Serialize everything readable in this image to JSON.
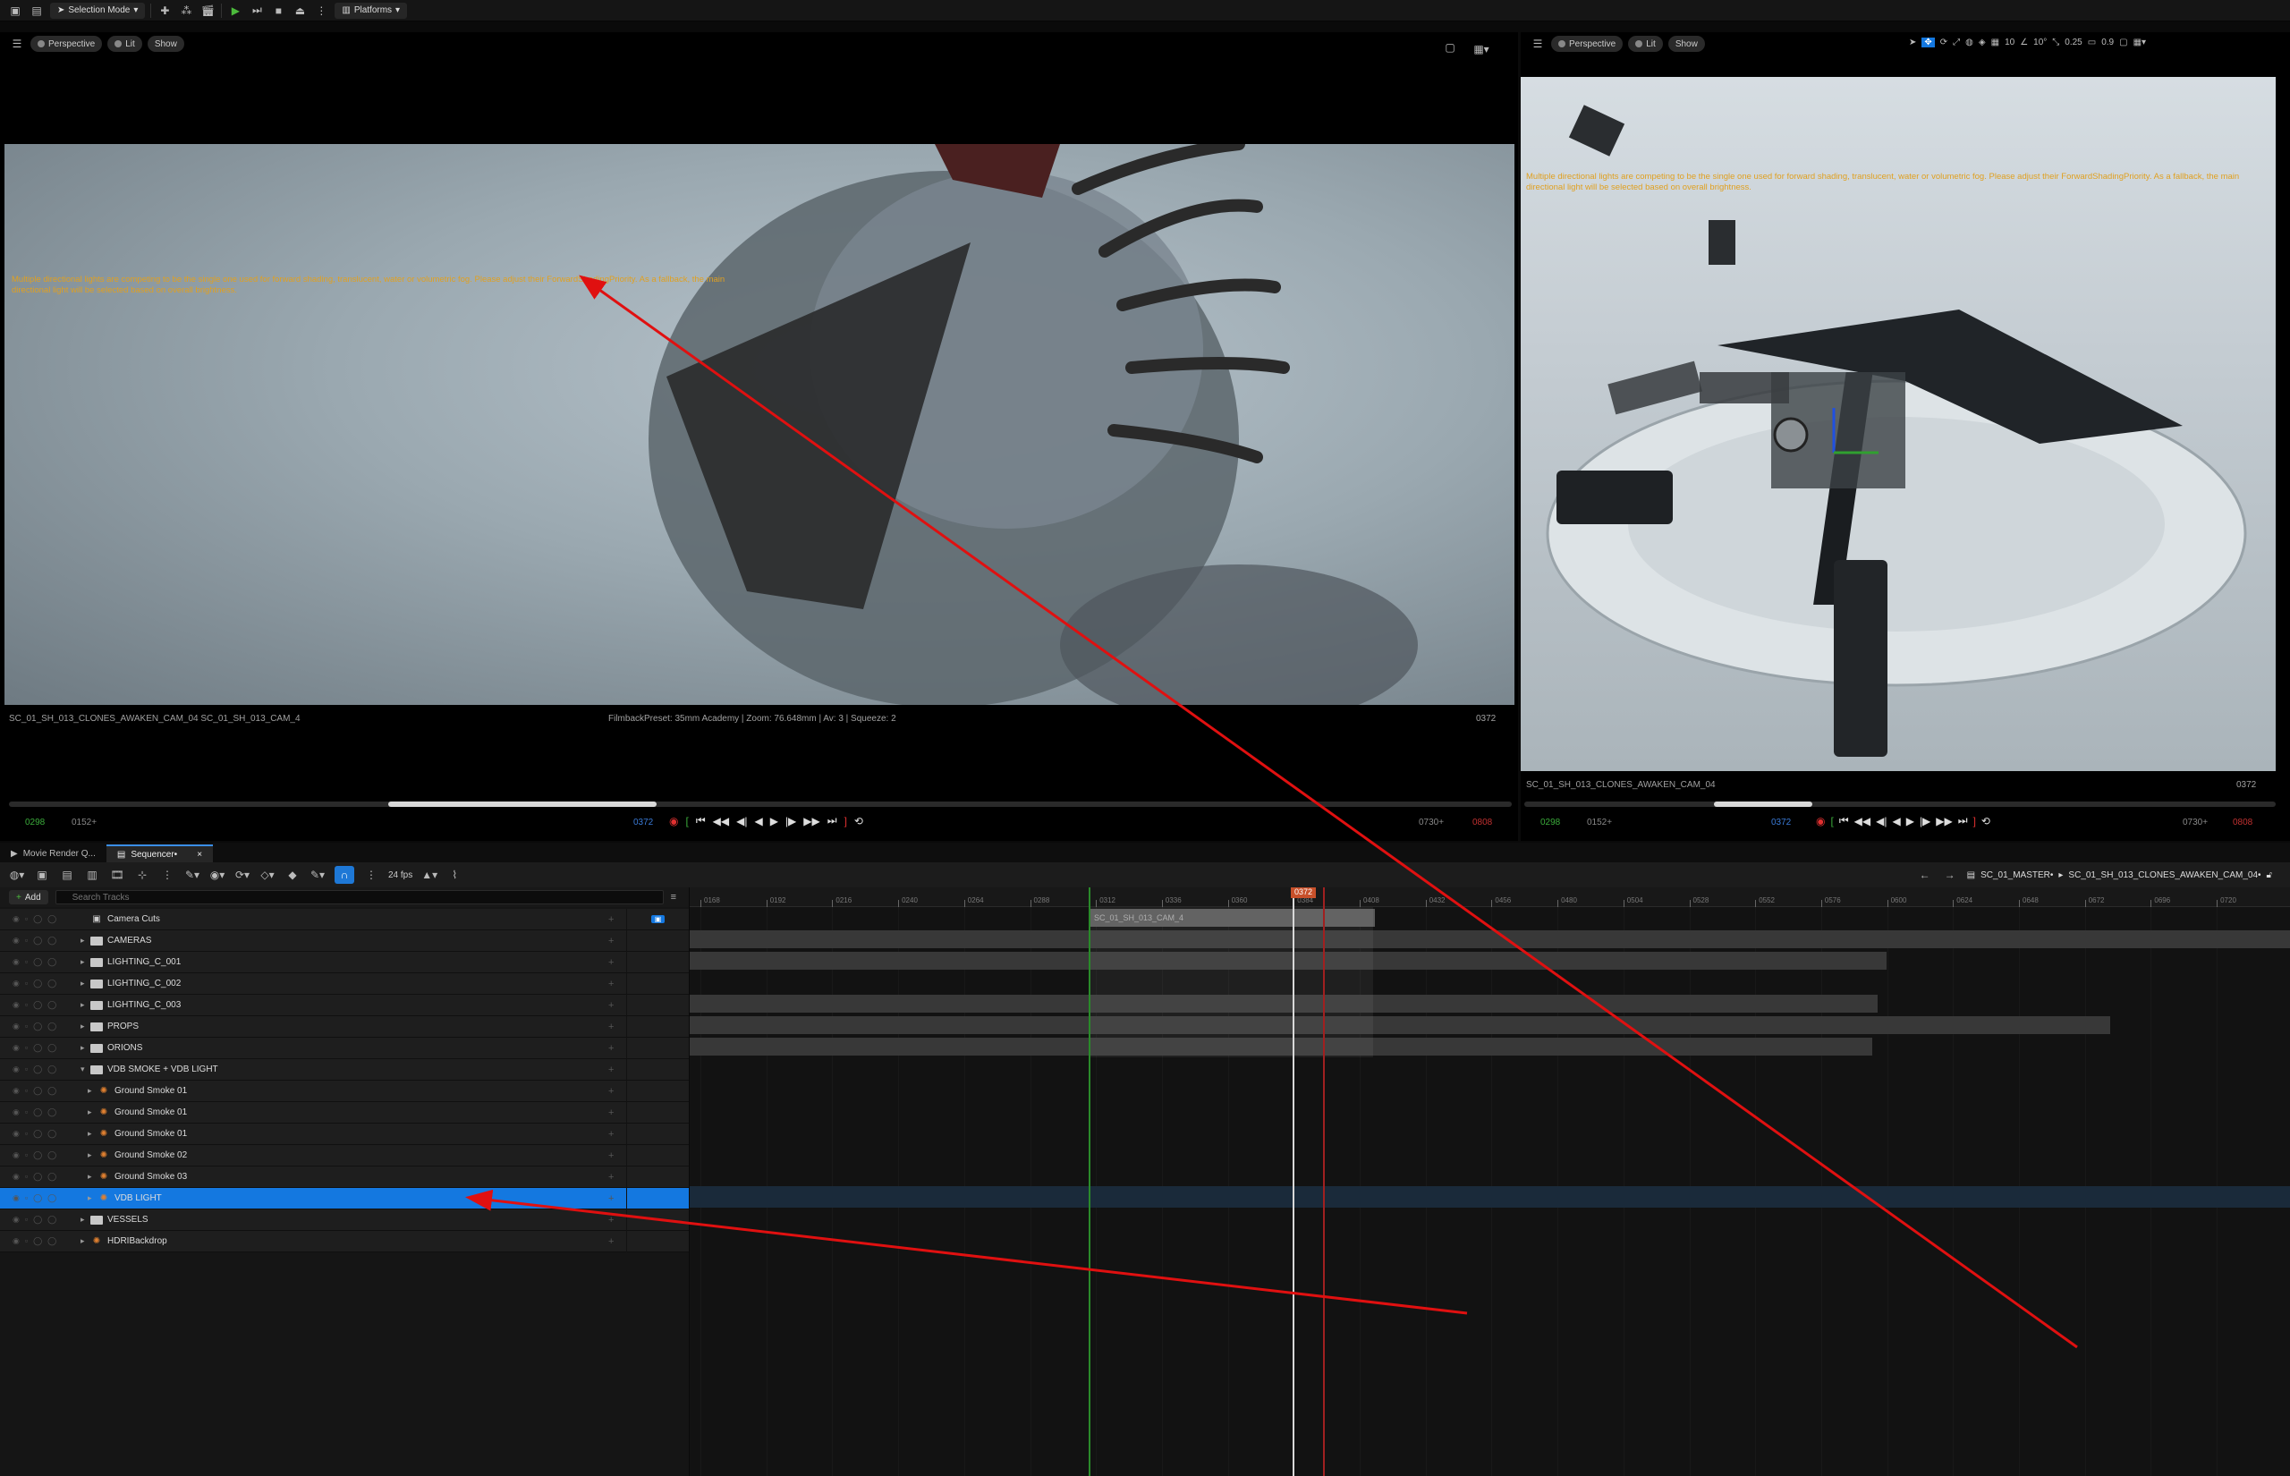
{
  "toolbar": {
    "selection_mode": "Selection Mode",
    "platforms": "Platforms"
  },
  "viewport_left": {
    "perspective": "Perspective",
    "lit": "Lit",
    "show": "Show",
    "warning": "Multiple directional lights are competing to be the single one used for forward shading, translucent, water or volumetric fog. Please adjust their ForwardShadingPriority. As a fallback, the main directional light will be selected based on overall brightness.",
    "camera_info": "SC_01_SH_013_CLONES_AWAKEN_CAM_04 SC_01_SH_013_CAM_4",
    "filmback": "FilmbackPreset: 35mm Academy | Zoom: 76.648mm | Av: 3 | Squeeze: 2",
    "frame_number": "0372",
    "start_frame": "0298",
    "start_offset": "0152+",
    "current_frame": "0372",
    "end_offset": "0730+",
    "end_frame": "0808",
    "playback_progress": 0.49
  },
  "viewport_right": {
    "perspective": "Perspective",
    "lit": "Lit",
    "show": "Show",
    "snap_values": [
      "10",
      "10°",
      "0.25",
      "0.9"
    ],
    "warning": "Multiple directional lights are competing to be the single one used for forward shading, translucent, water or volumetric fog. Please adjust their ForwardShadingPriority. As a fallback, the main directional light will be selected based on overall brightness.",
    "camera_info": "SC_01_SH_013_CLONES_AWAKEN_CAM_04",
    "frame_number": "0372",
    "start_frame": "0298",
    "start_offset": "0152+",
    "current_frame": "0372",
    "end_offset": "0730+",
    "end_frame": "0808",
    "playback_progress": 0.49
  },
  "tabs": [
    {
      "label": "Movie Render Q..."
    },
    {
      "label": "Sequencer•"
    }
  ],
  "sequencer": {
    "fps": "24 fps",
    "breadcrumb_master": "SC_01_MASTER•",
    "breadcrumb_shot": "SC_01_SH_013_CLONES_AWAKEN_CAM_04•",
    "add_label": "Add",
    "search_placeholder": "Search Tracks",
    "playhead_label": "0372",
    "camera_clip": "SC_01_SH_013_CAM_4",
    "ruler_labels": [
      "0168",
      "0192",
      "0216",
      "0240",
      "0264",
      "0288",
      "0312",
      "0336",
      "0360",
      "0384",
      "0408",
      "0432",
      "0456",
      "0480",
      "0504",
      "0528",
      "0552",
      "0576",
      "0600",
      "0624",
      "0648",
      "0672",
      "0696",
      "0720"
    ]
  },
  "tracks": [
    {
      "name": "Camera Cuts",
      "type": "camera"
    },
    {
      "name": "CAMERAS",
      "type": "folder"
    },
    {
      "name": "LIGHTING_C_001",
      "type": "folder"
    },
    {
      "name": "LIGHTING_C_002",
      "type": "folder"
    },
    {
      "name": "LIGHTING_C_003",
      "type": "folder"
    },
    {
      "name": "PROPS",
      "type": "folder"
    },
    {
      "name": "ORIONS",
      "type": "folder"
    },
    {
      "name": "VDB SMOKE + VDB LIGHT",
      "type": "folder-open"
    },
    {
      "name": "Ground Smoke 01",
      "type": "actor"
    },
    {
      "name": "Ground Smoke 01",
      "type": "actor"
    },
    {
      "name": "Ground Smoke 01",
      "type": "actor"
    },
    {
      "name": "Ground Smoke 02",
      "type": "actor"
    },
    {
      "name": "Ground Smoke 03",
      "type": "actor"
    },
    {
      "name": "VDB LIGHT",
      "type": "actor",
      "selected": true
    },
    {
      "name": "VESSELS",
      "type": "folder"
    },
    {
      "name": "HDRIBackdrop",
      "type": "actor"
    }
  ],
  "colors": {
    "accent": "#1478e0",
    "warning": "#e0a020",
    "annotation": "#e01010",
    "start_marker": "#2a8a2a",
    "end_marker": "#a02020"
  }
}
